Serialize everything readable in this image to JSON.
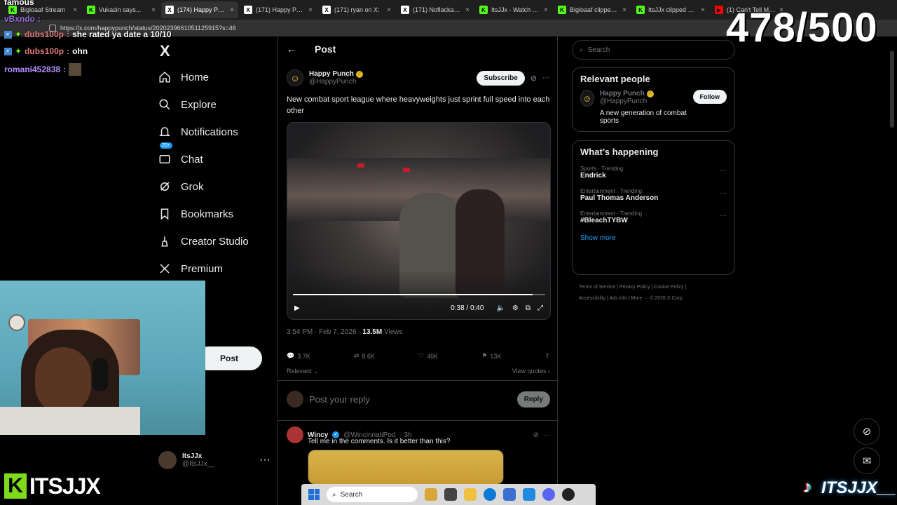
{
  "browser": {
    "tabs": [
      {
        "label": "Bigloaaf Stream",
        "fav": "K",
        "fav_color": "#53fc18"
      },
      {
        "label": "Vukasin says...",
        "fav": "K",
        "fav_color": "#53fc18"
      },
      {
        "label": "(174) Happy Punch o",
        "fav": "X",
        "fav_color": "#ffffff",
        "active": true
      },
      {
        "label": "(171) Happy Punch o",
        "fav": "X",
        "fav_color": "#ffffff"
      },
      {
        "label": "(171) ryan on X:",
        "fav": "X",
        "fav_color": "#ffffff"
      },
      {
        "label": "(171) Noflackaaa on",
        "fav": "X",
        "fav_color": "#ffffff"
      },
      {
        "label": "ItsJJx - Watch clips o",
        "fav": "K",
        "fav_color": "#53fc18"
      },
      {
        "label": "Bigloaaf clipped by I",
        "fav": "K",
        "fav_color": "#53fc18"
      },
      {
        "label": "ItsJJx clipped by Sea",
        "fav": "K",
        "fav_color": "#53fc18"
      },
      {
        "label": "(1) Can't Tell Me...",
        "fav": "▶",
        "fav_color": "#ff0000"
      }
    ],
    "url": "https://x.com/happypunch/status/2020239661051125915?s=46"
  },
  "overlay": {
    "counter": "478/500",
    "chat_title": "famous",
    "chat": [
      {
        "user": "vBxndo",
        "sep": ":",
        "msg": "",
        "color": "u3"
      },
      {
        "user": "dubs100p",
        "sep": ":",
        "msg": "she rated ya date a 10/10",
        "color": "u1"
      },
      {
        "user": "dubs100p",
        "sep": ":",
        "msg": "ohn",
        "color": "u1"
      },
      {
        "user": "romani452838",
        "sep": ":",
        "msg": "",
        "color": "u2"
      }
    ],
    "left_logo_letter": "K",
    "left_logo_text": "ITSJJX",
    "right_logo_text": "ITSJJX__"
  },
  "x": {
    "logo": "X",
    "nav": [
      {
        "label": "Home",
        "icon": "home-icon"
      },
      {
        "label": "Explore",
        "icon": "search-icon"
      },
      {
        "label": "Notifications",
        "icon": "bell-icon"
      },
      {
        "label": "Chat",
        "icon": "chat-icon",
        "badge": "20+"
      },
      {
        "label": "Grok",
        "icon": "grok-icon"
      },
      {
        "label": "Bookmarks",
        "icon": "bookmark-icon"
      },
      {
        "label": "Creator Studio",
        "icon": "creator-icon"
      },
      {
        "label": "Premium",
        "icon": "x-icon"
      }
    ],
    "post_button": "Post",
    "me": {
      "name": "ItsJJx",
      "handle": "@ItsJJx__"
    },
    "header_title": "Post",
    "post": {
      "author": "Happy Punch",
      "handle": "@HappyPunch",
      "subscribe": "Subscribe",
      "text": "New combat sport league where heavyweights just sprint full speed into each other",
      "video_time": "0:38 / 0:40",
      "video_progress": 0.95,
      "timestamp": "3:54 PM · Feb 7, 2026 ·",
      "views_count": "13.5M",
      "views_label": "Views",
      "replies": "3.7K",
      "reposts": "8.6K",
      "likes": "46K",
      "bookmarks": "13K",
      "sort": "Relevant",
      "view_quotes": "View quotes"
    },
    "reply_placeholder": "Post your reply",
    "reply_button": "Reply",
    "comment": {
      "author": "Wincy",
      "handle": "@WincinnatiPod",
      "time": "· 3h",
      "text": "Tell me in the comments. Is it better than this?"
    },
    "search_placeholder": "Search",
    "relevant": {
      "title": "Relevant people",
      "name": "Happy Punch",
      "handle": "@HappyPunch",
      "follow": "Follow",
      "bio": "A new generation of combat sports"
    },
    "happening": {
      "title": "What’s happening",
      "trends": [
        {
          "category": "Sports · Trending",
          "topic": "Endrick"
        },
        {
          "category": "Entertainment · Trending",
          "topic": "Paul Thomas Anderson"
        },
        {
          "category": "Entertainment · Trending",
          "topic": "#BleachTYBW"
        }
      ],
      "show_more": "Show more"
    },
    "footer": {
      "line1": "Terms of Service  |  Privacy Policy  |  Cookie Policy  |",
      "line2": "Accessibility  |  Ads info  |  More ···  © 2026 X Corp."
    }
  },
  "taskbar": {
    "search": "Search"
  }
}
